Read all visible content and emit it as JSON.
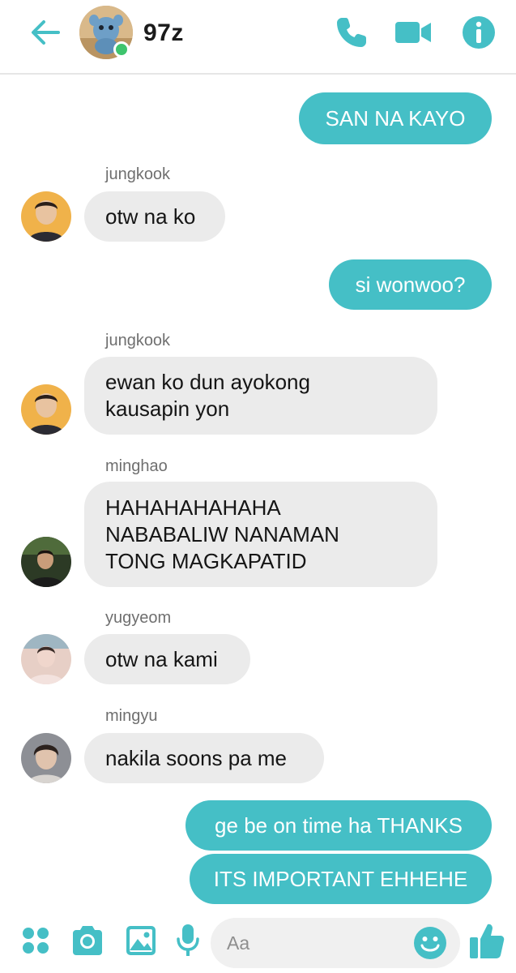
{
  "header": {
    "title": "97z",
    "accent_color": "#45bfc6",
    "online_color": "#3ec46d"
  },
  "messages": {
    "m1": {
      "text": "SAN NA KAYO"
    },
    "m2": {
      "sender": "jungkook",
      "text": "otw na ko"
    },
    "m3": {
      "text": "si wonwoo?"
    },
    "m4": {
      "sender": "jungkook",
      "text": "ewan ko dun ayokong\nkausapin yon"
    },
    "m5": {
      "sender": "minghao",
      "text": "HAHAHAHAHAHA\nNABABALIW NANAMAN\nTONG MAGKAPATID"
    },
    "m6": {
      "sender": "yugyeom",
      "text": "otw na kami"
    },
    "m7": {
      "sender": "mingyu",
      "text": "nakila soons pa me"
    },
    "m8": {
      "text": "ge be on time ha THANKS"
    },
    "m9": {
      "text": "ITS IMPORTANT EHHEHE"
    }
  },
  "composer": {
    "placeholder": "Aa",
    "icons": [
      "apps-icon",
      "camera-icon",
      "gallery-icon",
      "microphone-icon",
      "emoji-icon",
      "thumbs-up-icon"
    ]
  },
  "colors": {
    "outgoing_bubble": "#45bfc6",
    "incoming_bubble": "#ebebeb"
  }
}
